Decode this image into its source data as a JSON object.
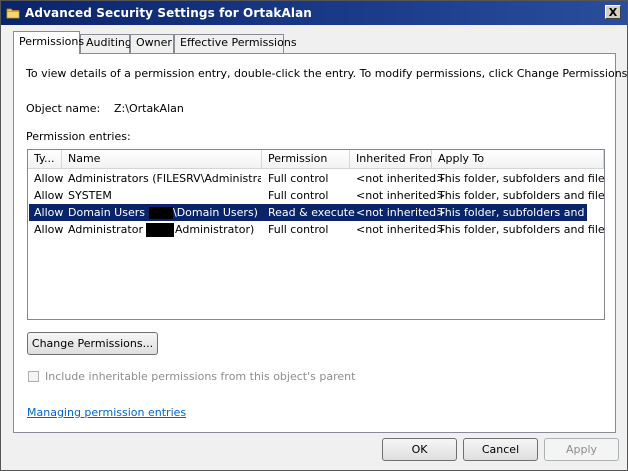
{
  "window": {
    "title": "Advanced Security Settings for OrtakAlan",
    "close_glyph": "X"
  },
  "tabs": [
    {
      "label": "Permissions",
      "active": true
    },
    {
      "label": "Auditing"
    },
    {
      "label": "Owner"
    },
    {
      "label": "Effective Permissions"
    }
  ],
  "permissions": {
    "instructions": "To view details of a permission entry, double-click the entry. To modify permissions, click Change Permissions.",
    "object_name_label": "Object name:",
    "object_name_value": "Z:\\OrtakAlan",
    "entries_label": "Permission entries:",
    "columns": [
      "Ty...",
      "Name",
      "Permission",
      "Inherited From",
      "Apply To"
    ],
    "rows": [
      {
        "type": "Allow",
        "name": "Administrators (FILESRV\\Administrators)",
        "name_pre": "",
        "name_post": "",
        "permission": "Full control",
        "inherited": "<not inherited>",
        "apply_to": "This folder, subfolders and files"
      },
      {
        "type": "Allow",
        "name": "SYSTEM",
        "name_pre": "",
        "name_post": "",
        "permission": "Full control",
        "inherited": "<not inherited>",
        "apply_to": "This folder, subfolders and files"
      },
      {
        "type": "Allow",
        "name": "",
        "name_pre": "Domain Users",
        "name_post": "\\Domain Users)",
        "permission": "Read & execute",
        "inherited": "<not inherited>",
        "apply_to": "This folder, subfolders and files",
        "selected": true
      },
      {
        "type": "Allow",
        "name": "",
        "name_pre": "Administrator",
        "name_post": "Administrator)",
        "permission": "Full control",
        "inherited": "<not inherited>",
        "apply_to": "This folder, subfolders and files"
      }
    ],
    "change_permissions_label": "Change Permissions...",
    "include_inheritable_label": "Include inheritable permissions from this object's parent",
    "include_inheritable_checked": false,
    "managing_link": "Managing permission entries"
  },
  "footer": {
    "ok_label": "OK",
    "cancel_label": "Cancel",
    "apply_label": "Apply"
  },
  "colors": {
    "titlebar": "#0a246a",
    "selection": "#0a246a",
    "link": "#0066cc"
  }
}
